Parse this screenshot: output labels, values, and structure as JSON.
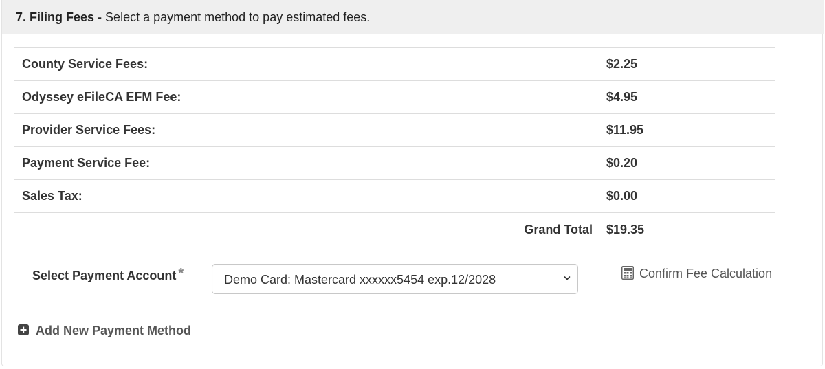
{
  "section": {
    "number_title": "7. Filing Fees -",
    "description": "Select a payment method to pay estimated fees."
  },
  "fees": [
    {
      "label": "County Service Fees:",
      "amount": "$2.25"
    },
    {
      "label": "Odyssey eFileCA EFM Fee:",
      "amount": "$4.95"
    },
    {
      "label": "Provider Service Fees:",
      "amount": "$11.95"
    },
    {
      "label": "Payment Service Fee:",
      "amount": "$0.20"
    },
    {
      "label": "Sales Tax:",
      "amount": "$0.00"
    }
  ],
  "total": {
    "label": "Grand Total",
    "amount": "$19.35"
  },
  "payment": {
    "label": "Select Payment Account",
    "required_marker": "*",
    "selected_value": "Demo Card: Mastercard xxxxxx5454 exp.12/2028"
  },
  "confirm_fee": {
    "label": "Confirm Fee Calculation",
    "icon": "calculator-icon"
  },
  "add_method": {
    "label": "Add New Payment Method",
    "icon": "plus-square-icon"
  }
}
